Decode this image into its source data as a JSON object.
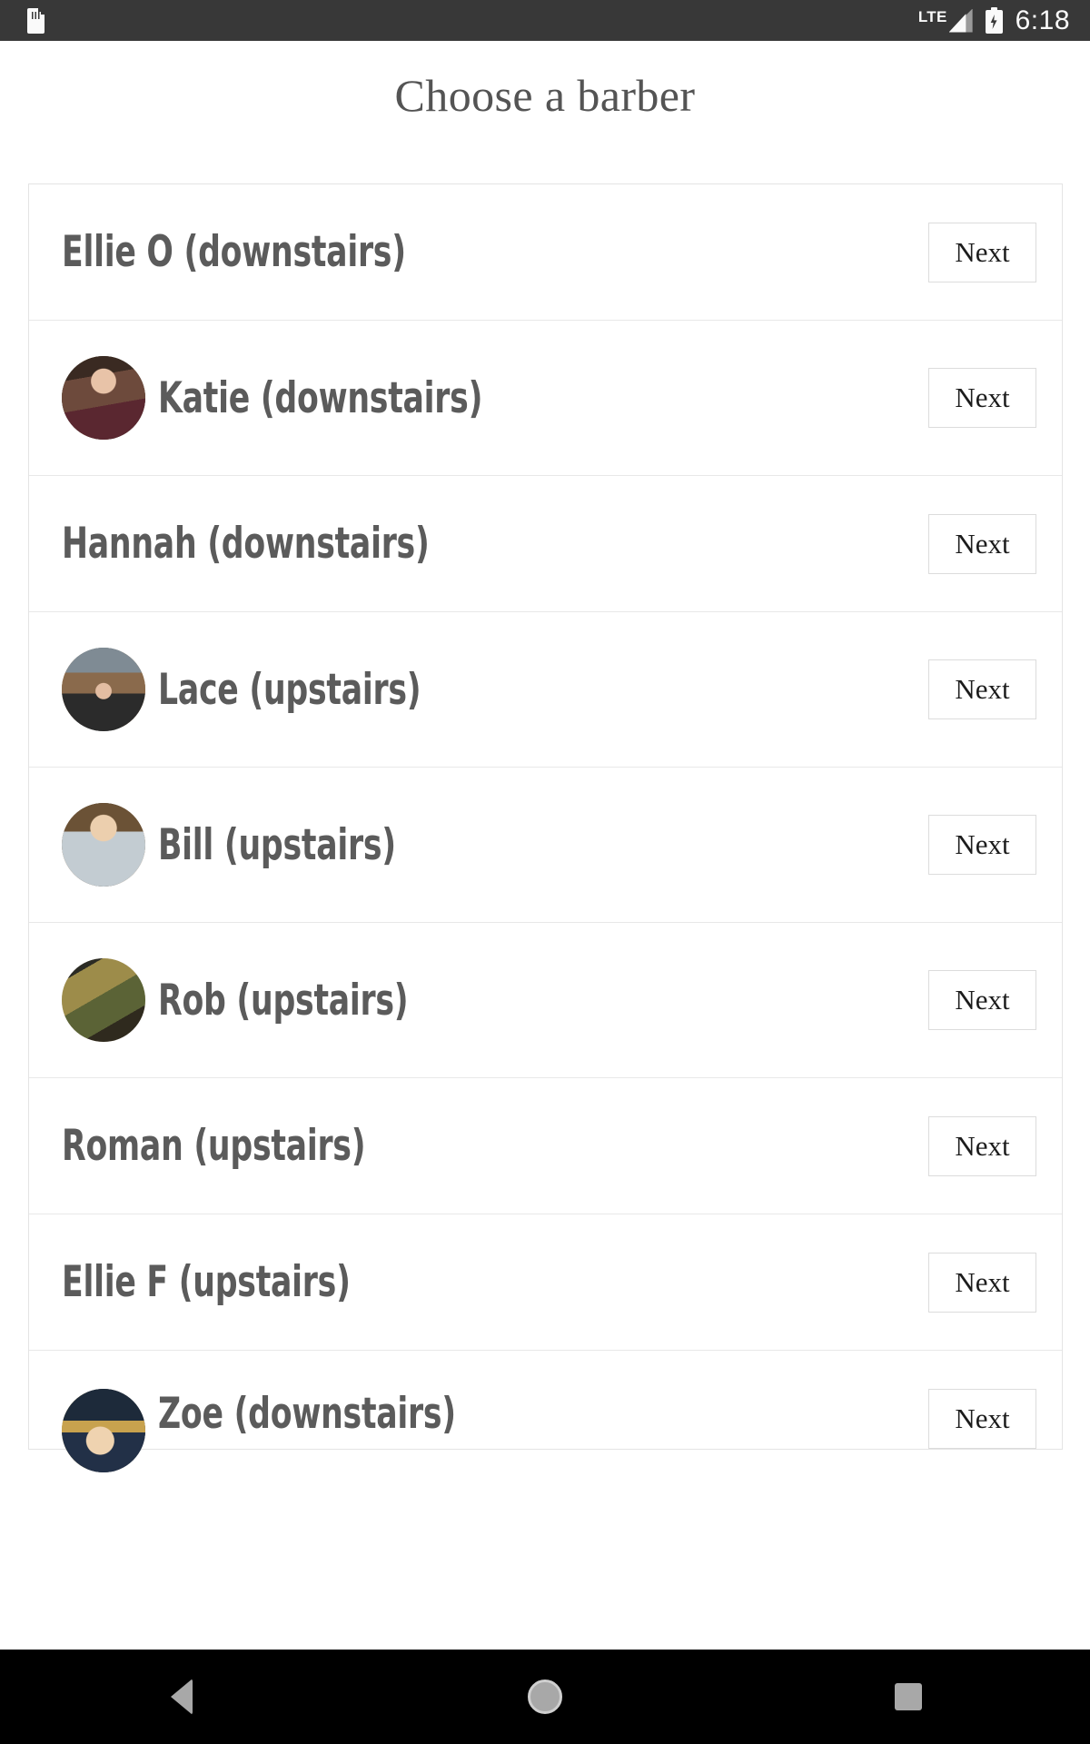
{
  "statusbar": {
    "sdcard_icon": "sdcard-icon",
    "network_label": "LTE",
    "signal_icon": "signal-bars-icon",
    "battery_icon": "battery-charging-icon",
    "time": "6:18"
  },
  "header": {
    "title": "Choose a barber"
  },
  "list": {
    "rows": [
      {
        "name": "Ellie O (downstairs)",
        "has_avatar": false,
        "next_label": "Next"
      },
      {
        "name": "Katie (downstairs)",
        "has_avatar": true,
        "next_label": "Next"
      },
      {
        "name": "Hannah (downstairs)",
        "has_avatar": false,
        "next_label": "Next"
      },
      {
        "name": "Lace (upstairs)",
        "has_avatar": true,
        "next_label": "Next"
      },
      {
        "name": "Bill (upstairs)",
        "has_avatar": true,
        "next_label": "Next"
      },
      {
        "name": "Rob (upstairs)",
        "has_avatar": true,
        "next_label": "Next"
      },
      {
        "name": "Roman (upstairs)",
        "has_avatar": false,
        "next_label": "Next"
      },
      {
        "name": "Ellie F (upstairs)",
        "has_avatar": false,
        "next_label": "Next"
      },
      {
        "name": "Zoe (downstairs)",
        "has_avatar": true,
        "next_label": "Next"
      }
    ]
  },
  "navbar": {
    "back_label": "back-icon",
    "home_label": "home-icon",
    "recents_label": "recents-icon"
  },
  "colors": {
    "statusbar_bg": "#383838",
    "navbar_bg": "#000000",
    "name_text": "#5b5b5b",
    "title_text": "#545454",
    "border": "#e4e4e4"
  }
}
